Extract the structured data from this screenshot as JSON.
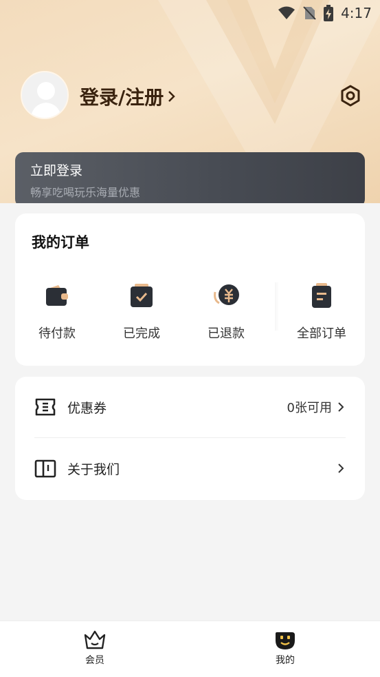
{
  "status_bar": {
    "time": "4:17",
    "icons": [
      "wifi-icon",
      "no-sim-icon",
      "battery-charging-icon"
    ]
  },
  "profile": {
    "login_label": "登录/注册",
    "avatar_icon": "avatar-placeholder-icon",
    "settings_icon": "settings-hexagon-icon"
  },
  "login_banner": {
    "title": "立即登录",
    "subtitle": "畅享吃喝玩乐海量优惠"
  },
  "orders": {
    "title": "我的订单",
    "items": [
      {
        "label": "待付款",
        "icon": "wallet-icon"
      },
      {
        "label": "已完成",
        "icon": "check-box-icon"
      },
      {
        "label": "已退款",
        "icon": "refund-yuan-icon"
      },
      {
        "label": "全部订单",
        "icon": "clipboard-icon"
      }
    ]
  },
  "menu": {
    "items": [
      {
        "label": "优惠券",
        "value": "0张可用",
        "icon": "ticket-icon"
      },
      {
        "label": "关于我们",
        "value": "",
        "icon": "book-icon"
      }
    ]
  },
  "tabbar": {
    "tabs": [
      {
        "label": "会员",
        "icon": "crown-icon"
      },
      {
        "label": "我的",
        "icon": "smiley-icon"
      }
    ]
  },
  "colors": {
    "accent_brown": "#3a230f",
    "header_gold": "#f3dcbd",
    "banner_dark": "#474b53"
  }
}
